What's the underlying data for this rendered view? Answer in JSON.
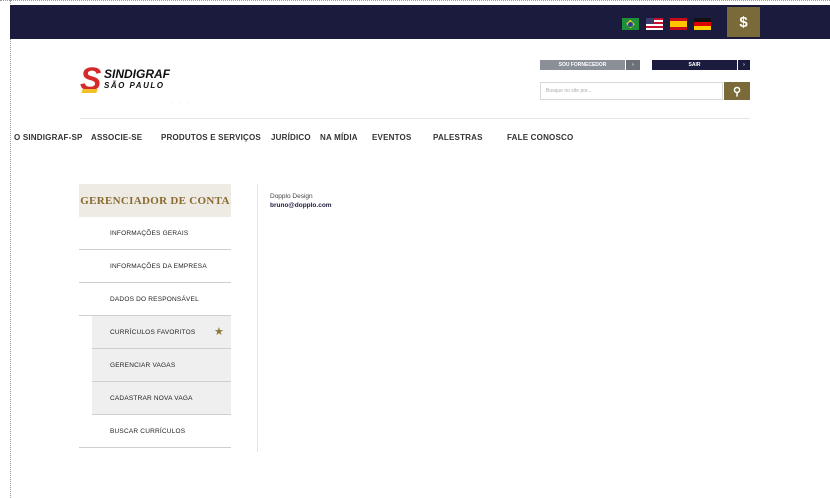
{
  "flags": [
    {
      "name": "brazil-flag-icon"
    },
    {
      "name": "usa-flag-icon"
    },
    {
      "name": "spain-flag-icon"
    },
    {
      "name": "germany-flag-icon"
    }
  ],
  "globe_glyph": "$",
  "logo": {
    "name": "SINDIGRAF",
    "sub": "SÃO PAULO"
  },
  "header": {
    "fornecedor_label": "SOU FORNECEDOR",
    "fornecedor_arrow": "›",
    "sair_label": "SAIR",
    "sair_arrow": "›",
    "search_placeholder": "Busque no site por...",
    "search_glyph": "⚲"
  },
  "nav": [
    "O SINDIGRAF-SP",
    "ASSOCIE-SE",
    "PRODUTOS E SERVIÇOS",
    "JURÍDICO",
    "NA MÍDIA",
    "EVENTOS",
    "PALESTRAS",
    "FALE CONOSCO"
  ],
  "sidebar": {
    "title": "GERENCIADOR DE CONTA",
    "items": [
      "INFORMAÇÕES GERAIS",
      "INFORMAÇÕES DA EMPRESA",
      "DADOS DO RESPONSÁVEL",
      "CURRÍCULOS FAVORITOS",
      "GERENCIAR VAGAS",
      "CADASTRAR NOVA VAGA",
      "BUSCAR CURRÍCULOS"
    ]
  },
  "account": {
    "company": "Dopplo Design",
    "email": "bruno@dopplo.com"
  },
  "colors": {
    "topbar": "#1a1b3d",
    "gold": "#7a6a3a",
    "brand_red": "#d42a2a"
  }
}
